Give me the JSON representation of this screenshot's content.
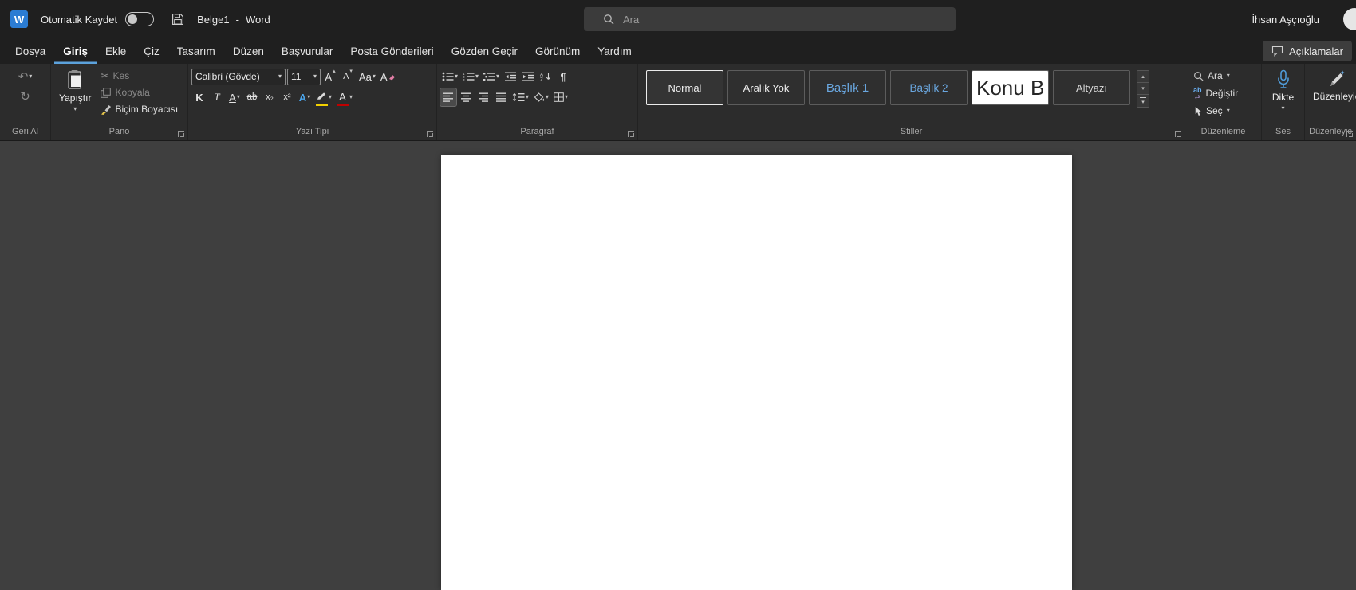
{
  "colors": {
    "titlebar_bg": "#1f1f1f",
    "ribbon_bg": "#2c2c2c",
    "canvas_bg": "#3f3f3f",
    "page_bg": "#ffffff",
    "accent_blue": "#5ca2dc",
    "heading_blue": "#6aa7e0",
    "highlight_yellow": "#f2d000",
    "font_color_red": "#c00000",
    "word_logo_blue": "#2b7cd3"
  },
  "titlebar": {
    "logo_letter": "W",
    "autosave_label": "Otomatik Kaydet",
    "autosave_state": "off",
    "document_title": "Belge1",
    "separator": "-",
    "app_name": "Word",
    "search_placeholder": "Ara",
    "user_name": "İhsan Aşçıoğlu"
  },
  "tabs": [
    {
      "label": "Dosya",
      "active": false
    },
    {
      "label": "Giriş",
      "active": true
    },
    {
      "label": "Ekle",
      "active": false
    },
    {
      "label": "Çiz",
      "active": false
    },
    {
      "label": "Tasarım",
      "active": false
    },
    {
      "label": "Düzen",
      "active": false
    },
    {
      "label": "Başvurular",
      "active": false
    },
    {
      "label": "Posta Gönderileri",
      "active": false
    },
    {
      "label": "Gözden Geçir",
      "active": false
    },
    {
      "label": "Görünüm",
      "active": false
    },
    {
      "label": "Yardım",
      "active": false
    }
  ],
  "comments_button_label": "Açıklamalar",
  "glyphs": {
    "caret_down": "▾",
    "caret_up": "▴",
    "undo": "↶",
    "redo": "↻",
    "cut": "✂",
    "pilcrow": "¶",
    "swap": "⇄"
  },
  "groups": {
    "undo": {
      "label": "Geri Al"
    },
    "clipboard": {
      "label": "Pano",
      "paste_label": "Yapıştır",
      "cut_label": "Kes",
      "copy_label": "Kopyala",
      "format_painter_label": "Biçim Boyacısı"
    },
    "font": {
      "label": "Yazı Tipi",
      "name_value": "Calibri (Gövde)",
      "size_value": "11",
      "grow": "A",
      "shrink": "A",
      "change_case": "Aa",
      "clear": "A",
      "bold": "K",
      "italic": "T",
      "underline": "A",
      "strikethrough": "ab",
      "subscript": "x₂",
      "superscript": "x²",
      "effects": "A",
      "font_color": "A"
    },
    "paragraph": {
      "label": "Paragraf"
    },
    "styles": {
      "label": "Stiller",
      "items": [
        {
          "name": "Normal",
          "selected": true
        },
        {
          "name": "Aralık Yok",
          "selected": false
        },
        {
          "name": "Başlık 1",
          "selected": false
        },
        {
          "name": "Başlık 2",
          "selected": false
        },
        {
          "name": "Konu B",
          "selected": false
        },
        {
          "name": "Altyazı",
          "selected": false
        }
      ]
    },
    "editing": {
      "label": "Düzenleme",
      "find_label": "Ara",
      "replace_label": "Değiştir",
      "replace_glyph": "ab",
      "select_label": "Seç"
    },
    "voice": {
      "label": "Ses",
      "dictate_label": "Dikte"
    },
    "editor": {
      "label": "Düzenleyic",
      "button_label": "Düzenleyic"
    }
  }
}
